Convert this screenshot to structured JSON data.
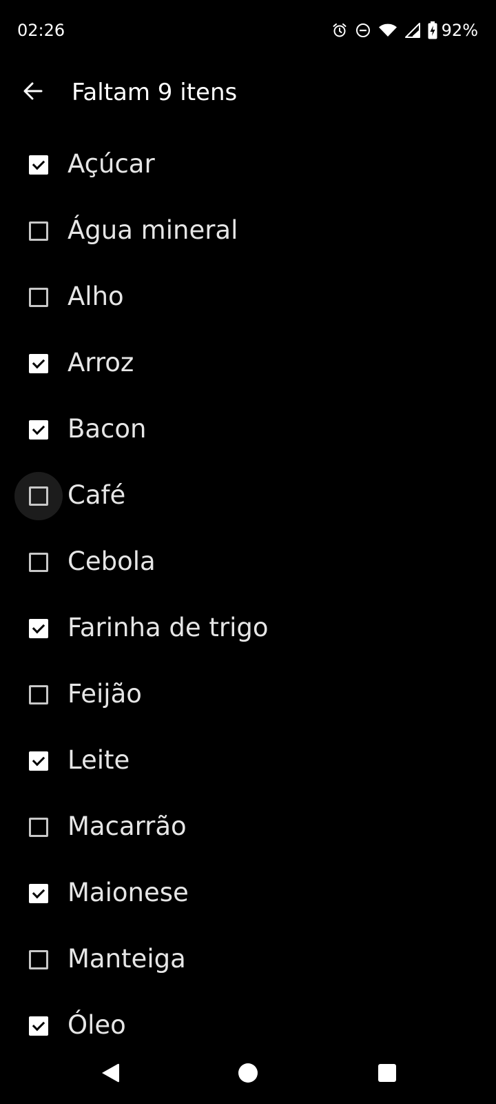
{
  "status_bar": {
    "time": "02:26",
    "icons": [
      "alarm-icon",
      "do-not-disturb-icon",
      "wifi-icon",
      "cellular-signal-icon",
      "battery-charging-icon"
    ],
    "battery": "92%"
  },
  "app_bar": {
    "back_icon": "arrow-left-icon",
    "title": "Faltam 9 itens"
  },
  "items": [
    {
      "label": "Açúcar",
      "checked": true
    },
    {
      "label": "Água mineral",
      "checked": false
    },
    {
      "label": "Alho",
      "checked": false
    },
    {
      "label": "Arroz",
      "checked": true
    },
    {
      "label": "Bacon",
      "checked": true
    },
    {
      "label": "Café",
      "checked": false,
      "focused": true
    },
    {
      "label": "Cebola",
      "checked": false
    },
    {
      "label": "Farinha de trigo",
      "checked": true
    },
    {
      "label": "Feijão",
      "checked": false
    },
    {
      "label": "Leite",
      "checked": true
    },
    {
      "label": "Macarrão",
      "checked": false
    },
    {
      "label": "Maionese",
      "checked": true
    },
    {
      "label": "Manteiga",
      "checked": false
    },
    {
      "label": "Óleo",
      "checked": true
    }
  ],
  "nav_bar": {
    "buttons": [
      "back-triangle-icon",
      "home-circle-icon",
      "recents-square-icon"
    ]
  },
  "colors": {
    "background": "#000000",
    "text": "#e6e6e6",
    "checkbox_checked": "#ffffff",
    "checkbox_border": "#c8c8c8",
    "focus_ripple": "#1c1c1c"
  }
}
